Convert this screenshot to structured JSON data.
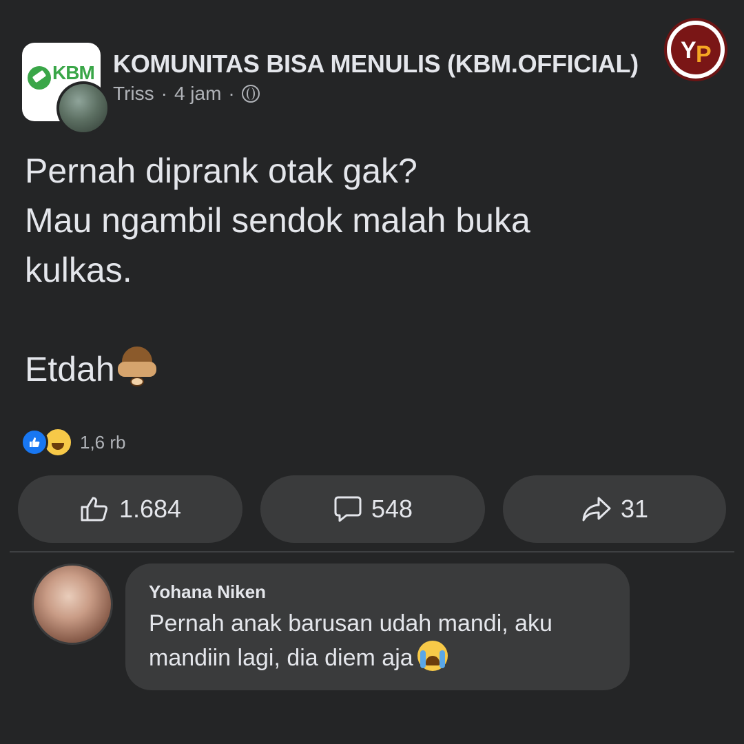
{
  "post": {
    "group_name": "KOMUNITAS BISA MENULIS (KBM.OFFICIAL)",
    "group_logo_text": "KBM",
    "author": "Triss",
    "separator": "·",
    "time": "4 jam",
    "privacy_icon": "globe-icon",
    "body_lines": [
      "Pernah diprank otak gak?",
      "Mau ngambil sendok malah buka",
      "kulkas."
    ],
    "closing_text": "Etdah",
    "closing_emoji": "see-no-evil-monkey"
  },
  "watermark": {
    "letters_y": "Y",
    "letters_p": "P",
    "accent": "#7a1616"
  },
  "reactions": {
    "types": [
      "like",
      "haha"
    ],
    "summary": "1,6 rb"
  },
  "actions": {
    "like_count": "1.684",
    "comment_count": "548",
    "share_count": "31"
  },
  "comment": {
    "author": "Yohana Niken",
    "text_lines": [
      "Pernah anak barusan udah mandi, aku",
      "mandiin lagi, dia diem aja"
    ],
    "emoji": "crying-face"
  },
  "colors": {
    "background": "#242526",
    "surface": "#3a3b3c",
    "text": "#e4e6eb",
    "muted": "#b0b3b8",
    "like_blue": "#1877f2",
    "haha_yellow": "#f7c948"
  }
}
